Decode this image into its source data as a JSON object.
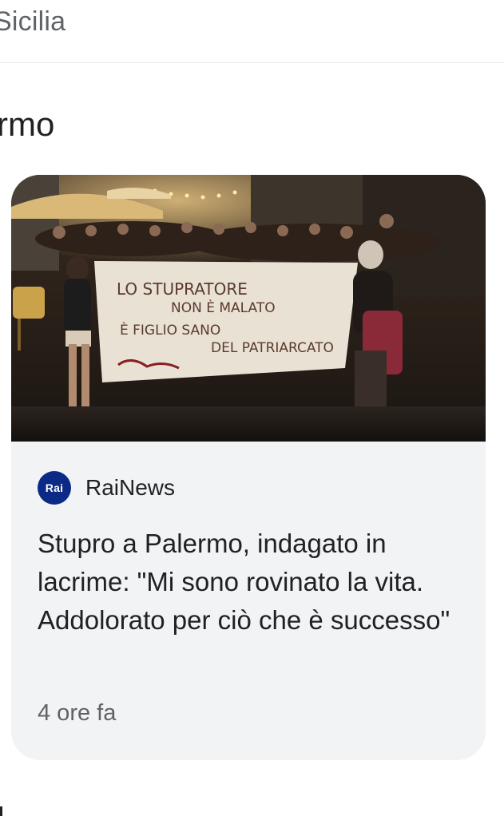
{
  "header": {
    "partial_label": "Sicilia"
  },
  "section": {
    "partial_title": "rmo"
  },
  "article": {
    "image_icon": "protest-photo",
    "source": {
      "logo_text": "Rai",
      "name": "RaiNews"
    },
    "headline": "Stupro a Palermo, indagato in lacrime: \"Mi sono rovinato la vita. Addolorato per ciò che è successo\"",
    "time": "4 ore fa",
    "banner_lines": [
      "LO STUPRATORE",
      "NON È MALATO",
      "È FIGLIO SANO",
      "DEL PATRIARCATO"
    ]
  },
  "colors": {
    "card_bg": "#f1f3f4",
    "rai_logo": "#0b2a85",
    "text_primary": "#202124",
    "text_secondary": "#5f6368"
  }
}
